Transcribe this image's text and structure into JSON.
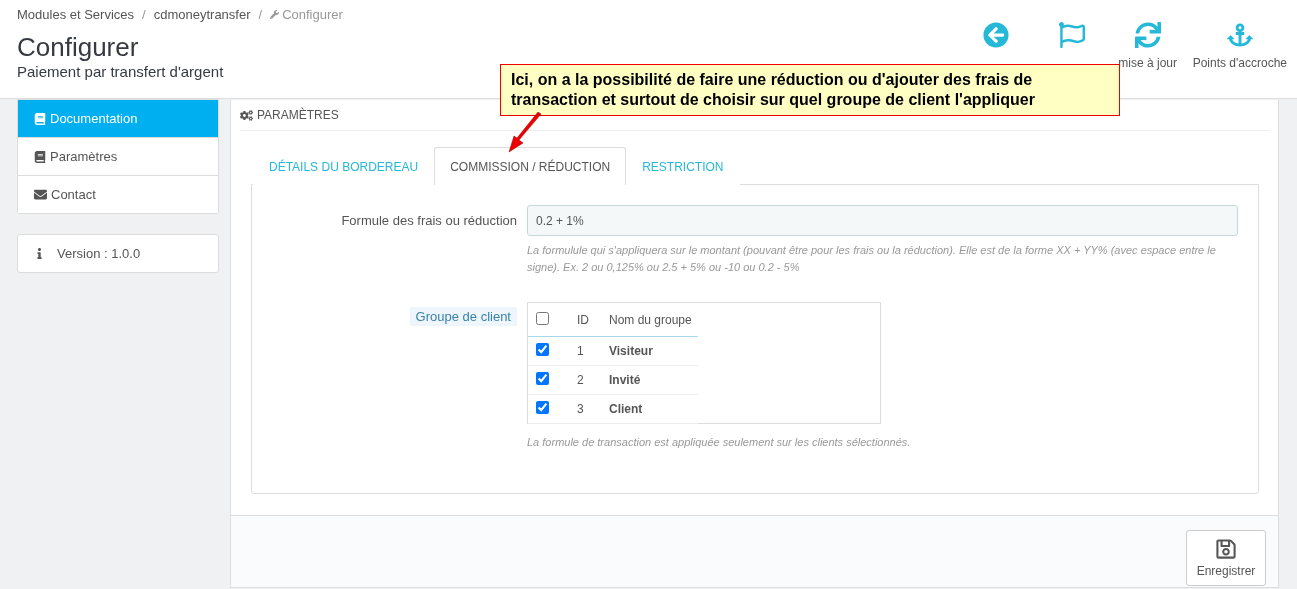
{
  "breadcrumb": [
    {
      "label": "Modules et Services",
      "kind": "link"
    },
    {
      "label": "cdmoneytransfer",
      "kind": "link"
    },
    {
      "label": "Configurer",
      "kind": "current"
    }
  ],
  "page": {
    "title": "Configurer",
    "subtitle": "Paiement par transfert d'argent"
  },
  "breadcrumb_separator": "/",
  "toolbar": [
    {
      "kind": "icon_only"
    },
    {
      "kind": "icon_only"
    },
    {
      "kind": "labeled",
      "label": "mise à jour"
    },
    {
      "kind": "labeled",
      "label": "Points d'accroche"
    }
  ],
  "callout": {
    "text": "Ici, on a la possibilité de faire une réduction ou d'ajouter des frais de transaction et surtout de choisir sur quel groupe de client l'appliquer"
  },
  "sidebar": {
    "items": [
      {
        "label": "Documentation",
        "selected": true
      },
      {
        "label": "Paramètres",
        "selected": false
      },
      {
        "label": "Contact",
        "selected": false
      }
    ],
    "version": "Version : 1.0.0"
  },
  "panel": {
    "title": "PARAMÈTRES",
    "tabs": [
      {
        "label": "DÉTAILS DU BORDEREAU",
        "selected": false
      },
      {
        "label": "COMMISSION / RÉDUCTION",
        "selected": true
      },
      {
        "label": "RESTRICTION",
        "selected": false
      }
    ],
    "formula": {
      "label": "Formule des frais ou réduction",
      "value": "0.2 + 1%",
      "help": "La formulule qui s'appliquera sur le montant (pouvant être pour les frais ou la réduction). Elle est de la forme XX + YY% (avec espace entre le signe). Ex. 2 ou 0,125% ou 2.5 + 5% ou -10 ou 0.2 - 5%"
    },
    "groups": {
      "label": "Groupe de client",
      "all_checked": false,
      "columns": [
        "ID",
        "Nom du groupe"
      ],
      "rows": [
        {
          "id": "1",
          "name": "Visiteur",
          "checked": true
        },
        {
          "id": "2",
          "name": "Invité",
          "checked": true
        },
        {
          "id": "3",
          "name": "Client",
          "checked": true
        }
      ],
      "help": "La formule de transaction est appliquée seulement sur les clients sélectionnés."
    }
  },
  "save_button": "Enregistrer"
}
